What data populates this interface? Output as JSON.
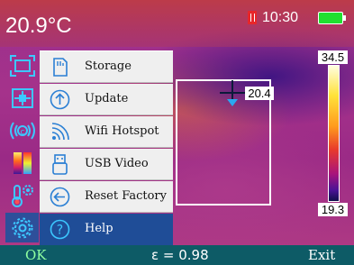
{
  "status": {
    "temperature": "20.9°C",
    "time": "10:30",
    "sd_card_icon": "sd-card-icon",
    "battery_icon": "battery-icon",
    "accent_battery": "#20e030"
  },
  "thermal_view": {
    "spot_temperature": "20.4",
    "scale_max": "34.5",
    "scale_min": "19.3",
    "crosshair_icon": "crosshair-icon"
  },
  "sidebar": {
    "items": [
      {
        "icon": "area-measure-icon",
        "selected": false
      },
      {
        "icon": "center-point-icon",
        "selected": false
      },
      {
        "icon": "emissivity-icon",
        "selected": false
      },
      {
        "icon": "color-palette-icon",
        "selected": false
      },
      {
        "icon": "temperature-settings-icon",
        "selected": false
      },
      {
        "icon": "settings-gear-icon",
        "selected": true
      }
    ]
  },
  "menu": {
    "items": [
      {
        "label": "Storage",
        "icon": "storage-icon",
        "selected": false
      },
      {
        "label": "Update",
        "icon": "update-icon",
        "selected": false
      },
      {
        "label": "Wifi Hotspot",
        "icon": "wifi-icon",
        "selected": false
      },
      {
        "label": "USB Video",
        "icon": "usb-icon",
        "selected": false
      },
      {
        "label": "Reset Factory",
        "icon": "reset-icon",
        "selected": false
      },
      {
        "label": "Help",
        "icon": "help-icon",
        "selected": true
      }
    ],
    "selected_color": "#1f4d97"
  },
  "footer": {
    "ok_label": "OK",
    "emissivity": "ε = 0.98",
    "exit_label": "Exit"
  }
}
